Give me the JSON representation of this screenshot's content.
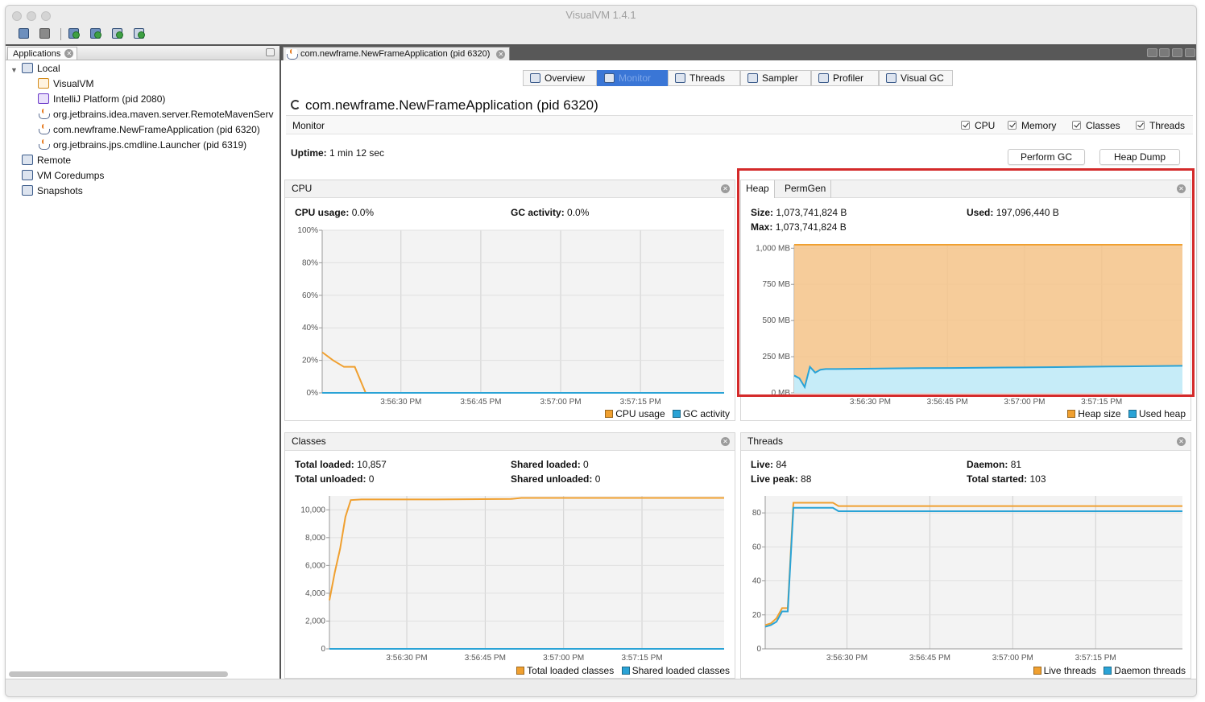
{
  "window": {
    "title": "VisualVM 1.4.1"
  },
  "toolbar": {
    "icons": [
      "open-icon",
      "save-icon",
      "add-jmx-icon",
      "add-remote-icon",
      "add-core-icon",
      "add-snapshot-icon"
    ]
  },
  "left_pane": {
    "tab": "Applications",
    "tree": [
      {
        "label": "Local",
        "icon": "computer-icon",
        "level": 0,
        "expanded": true
      },
      {
        "label": "VisualVM",
        "icon": "visualvm-icon",
        "level": 1
      },
      {
        "label": "IntelliJ Platform (pid 2080)",
        "icon": "intellij-icon",
        "level": 1
      },
      {
        "label": "org.jetbrains.idea.maven.server.RemoteMavenServ",
        "icon": "java-icon",
        "level": 1
      },
      {
        "label": "com.newframe.NewFrameApplication (pid 6320)",
        "icon": "java-icon",
        "level": 1
      },
      {
        "label": "org.jetbrains.jps.cmdline.Launcher (pid 6319)",
        "icon": "java-icon",
        "level": 1
      },
      {
        "label": "Remote",
        "icon": "remote-icon",
        "level": 0
      },
      {
        "label": "VM Coredumps",
        "icon": "coredump-icon",
        "level": 0
      },
      {
        "label": "Snapshots",
        "icon": "snapshot-icon",
        "level": 0
      }
    ]
  },
  "right_pane": {
    "doc_tab": "com.newframe.NewFrameApplication (pid 6320)",
    "subtabs": [
      {
        "label": "Overview",
        "icon": "overview-icon",
        "selected": false
      },
      {
        "label": "Monitor",
        "icon": "monitor-icon",
        "selected": true
      },
      {
        "label": "Threads",
        "icon": "threads-icon",
        "selected": false
      },
      {
        "label": "Sampler",
        "icon": "sampler-icon",
        "selected": false
      },
      {
        "label": "Profiler",
        "icon": "profiler-icon",
        "selected": false
      },
      {
        "label": "Visual GC",
        "icon": "visualgc-icon",
        "selected": false
      }
    ],
    "app_title": "com.newframe.NewFrameApplication",
    "app_pid": "(pid 6320)",
    "monitor_label": "Monitor",
    "checkboxes": [
      {
        "label": "CPU",
        "checked": true
      },
      {
        "label": "Memory",
        "checked": true
      },
      {
        "label": "Classes",
        "checked": true
      },
      {
        "label": "Threads",
        "checked": true
      }
    ],
    "uptime_label": "Uptime:",
    "uptime_value": "1 min 12 sec",
    "buttons": {
      "gc": "Perform GC",
      "heap_dump": "Heap Dump"
    }
  },
  "cpu": {
    "title": "CPU",
    "usage_label": "CPU usage:",
    "usage_value": "0.0%",
    "gc_label": "GC activity:",
    "gc_value": "0.0%"
  },
  "heap": {
    "tab_heap": "Heap",
    "tab_permgen": "PermGen",
    "size_label": "Size:",
    "size_value": "1,073,741,824 B",
    "max_label": "Max:",
    "max_value": "1,073,741,824 B",
    "used_label": "Used:",
    "used_value": "197,096,440 B"
  },
  "classes": {
    "title": "Classes",
    "total_loaded_label": "Total loaded:",
    "total_loaded_value": "10,857",
    "total_unloaded_label": "Total unloaded:",
    "total_unloaded_value": "0",
    "shared_loaded_label": "Shared loaded:",
    "shared_loaded_value": "0",
    "shared_unloaded_label": "Shared unloaded:",
    "shared_unloaded_value": "0"
  },
  "threads": {
    "title": "Threads",
    "live_label": "Live:",
    "live_value": "84",
    "peak_label": "Live peak:",
    "peak_value": "88",
    "daemon_label": "Daemon:",
    "daemon_value": "81",
    "started_label": "Total started:",
    "started_value": "103"
  },
  "colors": {
    "orange": "#f0a030",
    "blue": "#2aa3d6",
    "orange_fill": "#f6c48a",
    "blue_fill": "#c6ecf8",
    "highlight": "#d42a2a"
  },
  "chart_data": [
    {
      "id": "cpu",
      "type": "line",
      "xticks": [
        "3:56:30 PM",
        "3:56:45 PM",
        "3:57:00 PM",
        "3:57:15 PM"
      ],
      "yticks": [
        "100%",
        "80%",
        "60%",
        "40%",
        "20%",
        "0%"
      ],
      "ylim": [
        0,
        100
      ],
      "series": [
        {
          "name": "CPU usage",
          "color": "#f0a030",
          "x": [
            0,
            2,
            4,
            6,
            8,
            10,
            74
          ],
          "y": [
            25,
            20,
            16,
            16,
            0,
            0,
            0
          ]
        },
        {
          "name": "GC activity",
          "color": "#2aa3d6",
          "x": [
            0,
            74
          ],
          "y": [
            0,
            0
          ]
        }
      ]
    },
    {
      "id": "heap",
      "type": "area",
      "xticks": [
        "3:56:30 PM",
        "3:56:45 PM",
        "3:57:00 PM",
        "3:57:15 PM"
      ],
      "yticks": [
        "1,000 MB",
        "750 MB",
        "500 MB",
        "250 MB",
        "0 MB"
      ],
      "ylim": [
        0,
        1024
      ],
      "series": [
        {
          "name": "Heap size",
          "color": "#f0a030",
          "x": [
            0,
            74
          ],
          "y": [
            1024,
            1024
          ]
        },
        {
          "name": "Used heap",
          "color": "#2aa3d6",
          "x": [
            0,
            1,
            2,
            3,
            4,
            5,
            6,
            8,
            20,
            30,
            40,
            50,
            60,
            74
          ],
          "y": [
            120,
            100,
            40,
            180,
            140,
            160,
            165,
            165,
            170,
            172,
            175,
            178,
            182,
            187
          ]
        }
      ]
    },
    {
      "id": "classes",
      "type": "line",
      "xticks": [
        "3:56:30 PM",
        "3:56:45 PM",
        "3:57:00 PM",
        "3:57:15 PM"
      ],
      "yticks": [
        "10,000",
        "8,000",
        "6,000",
        "4,000",
        "2,000",
        "0"
      ],
      "ylim": [
        0,
        11000
      ],
      "series": [
        {
          "name": "Total loaded classes",
          "color": "#f0a030",
          "x": [
            0,
            1,
            2,
            3,
            4,
            6,
            20,
            34,
            36,
            74
          ],
          "y": [
            3500,
            5500,
            7200,
            9500,
            10700,
            10750,
            10750,
            10780,
            10857,
            10857
          ]
        },
        {
          "name": "Shared loaded classes",
          "color": "#2aa3d6",
          "x": [
            0,
            74
          ],
          "y": [
            0,
            0
          ]
        }
      ]
    },
    {
      "id": "threads",
      "type": "line",
      "xticks": [
        "3:56:30 PM",
        "3:56:45 PM",
        "3:57:00 PM",
        "3:57:15 PM"
      ],
      "yticks": [
        "80",
        "60",
        "40",
        "20",
        "0"
      ],
      "ylim": [
        0,
        90
      ],
      "series": [
        {
          "name": "Live threads",
          "color": "#f0a030",
          "x": [
            0,
            1,
            2,
            3,
            4,
            5,
            6,
            12,
            13,
            74
          ],
          "y": [
            14,
            15,
            18,
            24,
            24,
            86,
            86,
            86,
            84,
            84
          ]
        },
        {
          "name": "Daemon threads",
          "color": "#2aa3d6",
          "x": [
            0,
            1,
            2,
            3,
            4,
            5,
            6,
            12,
            13,
            74
          ],
          "y": [
            13,
            14,
            16,
            22,
            22,
            83,
            83,
            83,
            81,
            81
          ]
        }
      ]
    }
  ]
}
